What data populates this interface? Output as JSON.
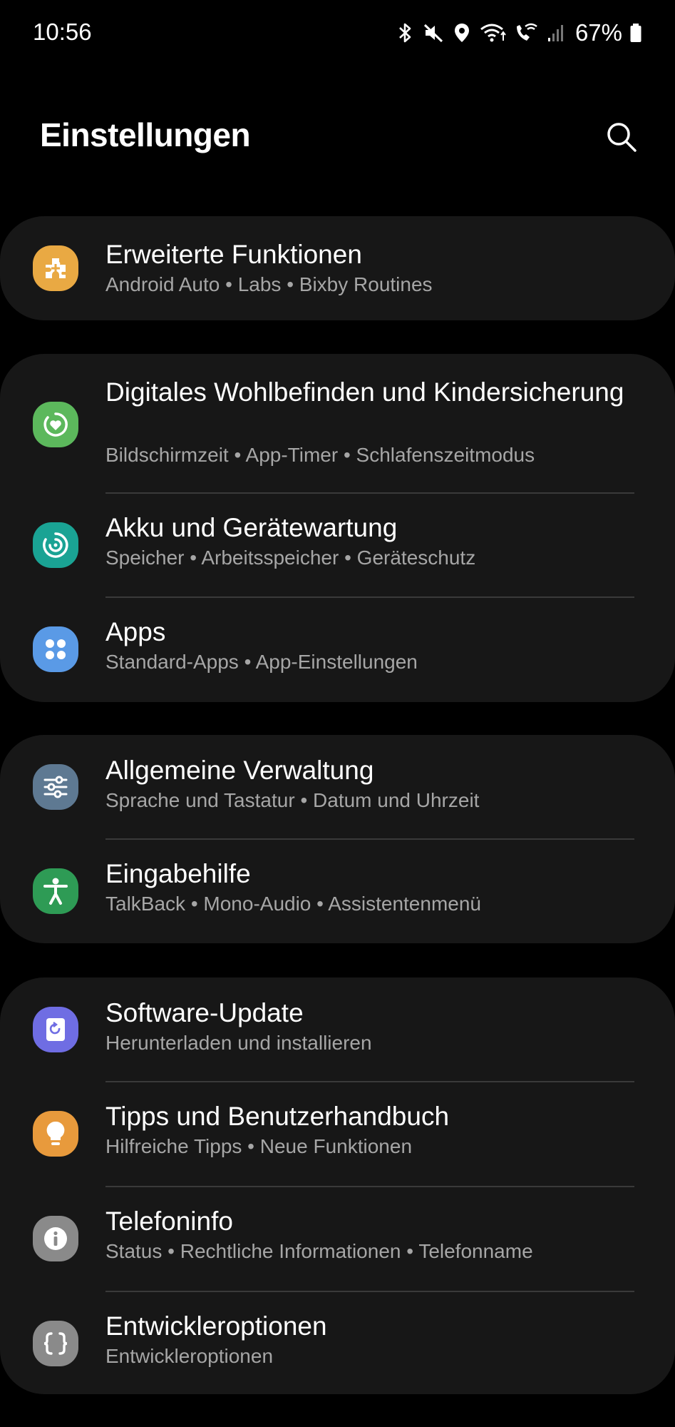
{
  "status": {
    "time": "10:56",
    "battery": "67%",
    "icons": [
      "bluetooth-icon",
      "mute-icon",
      "location-icon",
      "wifi-icon",
      "wifi-calling-icon",
      "signal-icon",
      "battery-icon"
    ]
  },
  "header": {
    "title": "Einstellungen",
    "search_icon": "search-icon"
  },
  "items": [
    {
      "title": "Erweiterte Funktionen",
      "subtitle": "Android Auto  •  Labs  •  Bixby Routines",
      "icon": "puzzle-plus-icon",
      "color": "#e9a943"
    },
    {
      "title": "Digitales Wohlbefinden und Kindersicherung",
      "subtitle": "Bildschirmzeit  •  App-Timer  •  Schlafenszeitmodus",
      "icon": "heart-circle-icon",
      "color": "#5cb85c"
    },
    {
      "title": "Akku und Gerätewartung",
      "subtitle": "Speicher  •  Arbeitsspeicher  •  Geräteschutz",
      "icon": "device-care-icon",
      "color": "#1aa394"
    },
    {
      "title": "Apps",
      "subtitle": "Standard-Apps  •  App-Einstellungen",
      "icon": "apps-grid-icon",
      "color": "#5a9ae6"
    },
    {
      "title": "Allgemeine Verwaltung",
      "subtitle": "Sprache und Tastatur  •  Datum und Uhrzeit",
      "icon": "sliders-icon",
      "color": "#5e7992"
    },
    {
      "title": "Eingabehilfe",
      "subtitle": "TalkBack  •  Mono-Audio  •  Assistentenmenü",
      "icon": "accessibility-icon",
      "color": "#2e9b55"
    },
    {
      "title": "Software-Update",
      "subtitle": "Herunterladen und installieren",
      "icon": "update-icon",
      "color": "#6f6de3"
    },
    {
      "title": "Tipps und Benutzerhandbuch",
      "subtitle": "Hilfreiche Tipps  •  Neue Funktionen",
      "icon": "lightbulb-icon",
      "color": "#e89a3c"
    },
    {
      "title": "Telefoninfo",
      "subtitle": "Status  •  Rechtliche Informationen  •  Telefonname",
      "icon": "info-icon",
      "color": "#8a8a8a"
    },
    {
      "title": "Entwickleroptionen",
      "subtitle": "Entwickleroptionen",
      "icon": "braces-icon",
      "color": "#8a8a8a"
    }
  ]
}
